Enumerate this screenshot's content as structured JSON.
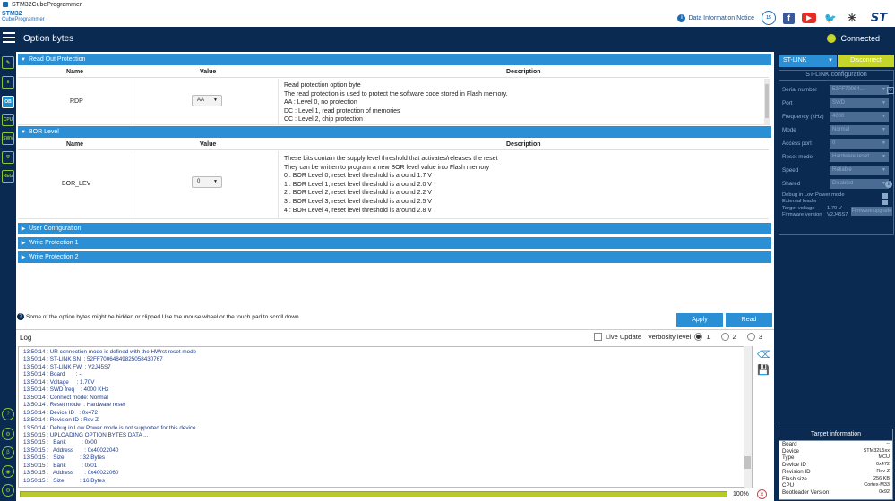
{
  "window": {
    "title": "STM32CubeProgrammer"
  },
  "brand": {
    "logo_line1": "STM32",
    "logo_line2": "CubeProgrammer"
  },
  "header_links": {
    "info_notice": "Data Information Notice",
    "badge_icon": "anniversary-badge-icon",
    "facebook_icon": "facebook-icon",
    "youtube_icon": "youtube-icon",
    "twitter_icon": "twitter-icon",
    "network_icon": "network-icon",
    "st_logo": "st-logo"
  },
  "topbar": {
    "title": "Option bytes",
    "status": "Connected",
    "status_color": "#c6d52a"
  },
  "sidebar": {
    "items": [
      "edit-icon",
      "download-icon",
      "OB",
      "CPU",
      "SWV",
      "security-icon",
      "REG"
    ],
    "bottom": [
      "help-icon",
      "plugin-icon",
      "beta-icon",
      "circle-icon",
      "settings-icon"
    ]
  },
  "sections": {
    "read_out": {
      "title": "Read Out Protection",
      "columns": {
        "name": "Name",
        "value": "Value",
        "description": "Description"
      },
      "rows": [
        {
          "name": "RDP",
          "value": "AA",
          "description": [
            "Read protection option byte",
            "The read protection is used to protect the software code stored in Flash memory.",
            "AA : Level 0, no protection",
            "DC : Level 1, read protection of memories",
            "CC : Level 2, chip protection"
          ]
        }
      ]
    },
    "bor": {
      "title": "BOR Level",
      "columns": {
        "name": "Name",
        "value": "Value",
        "description": "Description"
      },
      "rows": [
        {
          "name": "BOR_LEV",
          "value": "0",
          "description": [
            "These bits contain the supply level threshold that activates/releases the reset",
            "They can be written to program a new BOR level value into Flash memory",
            "0 : BOR Level 0, reset level threshold is around 1.7 V",
            "1 : BOR Level 1, reset level threshold is around 2.0 V",
            "2 : BOR Level 2, reset level threshold is around 2.2 V",
            "3 : BOR Level 3, reset level threshold is around 2.5 V",
            "4 : BOR Level 4, reset level threshold is around 2.8 V"
          ]
        }
      ]
    },
    "collapsed": [
      "User Configuration",
      "Write Protection 1",
      "Write Protection 2"
    ]
  },
  "hint": "Some of the option bytes might be hidden or clipped.Use the mouse wheel or the touch pad to scroll down",
  "actions": {
    "apply": "Apply",
    "read": "Read"
  },
  "log": {
    "title": "Log",
    "live_update": "Live Update",
    "verbosity_label": "Verbosity level",
    "verbosity_options": [
      "1",
      "2",
      "3"
    ],
    "verbosity_selected": "1",
    "lines": [
      "13:50:14 : UR connection mode is defined with the HWrst reset mode",
      "13:50:14 : ST-LINK SN  : 52FF70064849825058430767",
      "13:50:14 : ST-LINK FW  : V2J45S7",
      "13:50:14 : Board       : --",
      "13:50:14 : Voltage     : 1.70V",
      "13:50:14 : SWD freq    : 4000 KHz",
      "13:50:14 : Connect mode: Normal",
      "13:50:14 : Reset mode  : Hardware reset",
      "13:50:14 : Device ID   : 0x472",
      "13:50:14 : Revision ID : Rev Z",
      "13:50:14 : Debug in Low Power mode is not supported for this device.",
      "13:50:15 : UPLOADING OPTION BYTES DATA ...",
      "13:50:15 :   Bank          : 0x00",
      "13:50:15 :   Address       : 0x40022040",
      "13:50:15 :   Size          : 32 Bytes",
      "13:50:15 :   Bank          : 0x01",
      "13:50:15 :   Address       : 0x40022060",
      "13:50:15 :   Size          : 16 Bytes"
    ],
    "progress_percent": 100,
    "progress_label": "100%"
  },
  "connection_panel": {
    "interface": "ST-LINK",
    "disconnect": "Disconnect",
    "config_title": "ST-LINK configuration",
    "fields": [
      {
        "label": "Serial number",
        "value": "52FF70064..."
      },
      {
        "label": "Port",
        "value": "SWD"
      },
      {
        "label": "Frequency (kHz)",
        "value": "4000"
      },
      {
        "label": "Mode",
        "value": "Normal"
      },
      {
        "label": "Access port",
        "value": "0"
      },
      {
        "label": "Reset mode",
        "value": "Hardware reset"
      },
      {
        "label": "Speed",
        "value": "Reliable"
      },
      {
        "label": "Shared",
        "value": "Disabled"
      }
    ],
    "debug_low_power": "Debug in Low Power mode",
    "external_loader": "External loader",
    "target_voltage_label": "Target voltage",
    "target_voltage": "1.70 V",
    "firmware_version_label": "Firmware version",
    "firmware_version": "V2J45S7",
    "firmware_upgrade": "Firmware upgrade"
  },
  "target_info": {
    "title": "Target information",
    "rows": [
      {
        "label": "Board",
        "value": "--"
      },
      {
        "label": "Device",
        "value": "STM32L5xx"
      },
      {
        "label": "Type",
        "value": "MCU"
      },
      {
        "label": "Device ID",
        "value": "0x472"
      },
      {
        "label": "Revision ID",
        "value": "Rev Z"
      },
      {
        "label": "Flash size",
        "value": "256 KB"
      },
      {
        "label": "CPU",
        "value": "Cortex-M33"
      },
      {
        "label": "Bootloader Version",
        "value": "0x92"
      }
    ]
  }
}
